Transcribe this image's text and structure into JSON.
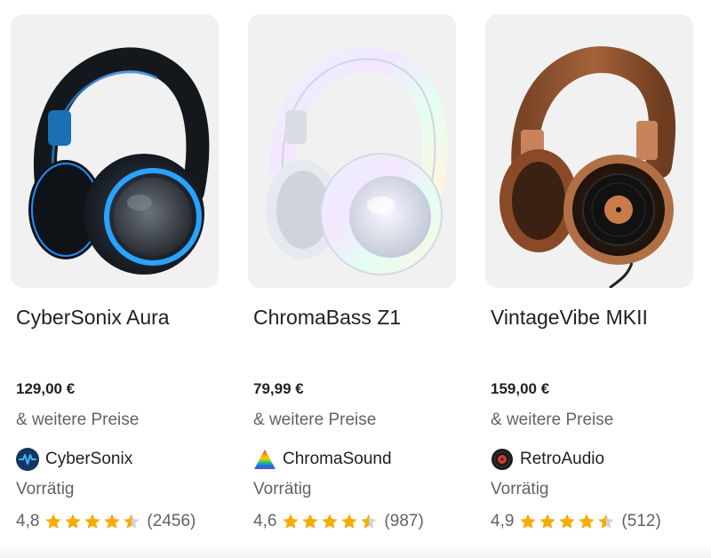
{
  "colors": {
    "price_text": "#202124",
    "secondary_text": "#5f6368",
    "star": "#f9ab00",
    "tile_background": "#f1f1f1"
  },
  "products": [
    {
      "title": "CyberSonix Aura",
      "price": "129,00 €",
      "more_prices": "& weitere Preise",
      "seller": "CyberSonix",
      "seller_icon": "waveform-logo-icon",
      "availability": "Vorrätig",
      "rating": "4,8",
      "rating_value": 4.8,
      "reviews": "(2456)",
      "image": "black-blue-headphones-image"
    },
    {
      "title": "ChromaBass Z1",
      "price": "79,99 €",
      "more_prices": "& weitere Preise",
      "seller": "ChromaSound",
      "seller_icon": "rainbow-triangle-logo-icon",
      "availability": "Vorrätig",
      "rating": "4,6",
      "rating_value": 4.6,
      "reviews": "(987)",
      "image": "holographic-white-headphones-image"
    },
    {
      "title": "VintageVibe MKII",
      "price": "159,00 €",
      "more_prices": "& weitere Preise",
      "seller": "RetroAudio",
      "seller_icon": "vinyl-record-logo-icon",
      "availability": "Vorrätig",
      "rating": "4,9",
      "rating_value": 4.9,
      "reviews": "(512)",
      "image": "brown-leather-headphones-image"
    }
  ]
}
